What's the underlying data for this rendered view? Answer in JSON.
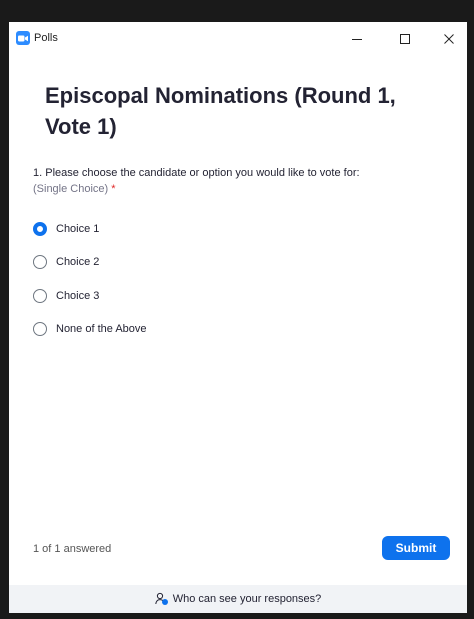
{
  "window": {
    "title": "Polls",
    "app_icon": "zoom-video-icon",
    "controls": {
      "minimize_icon": "minimize-icon",
      "maximize_icon": "maximize-icon",
      "close_icon": "close-icon"
    }
  },
  "poll": {
    "title": "Episcopal Nominations (Round 1, Vote 1)",
    "question": {
      "text": "1. Please choose the candidate or option you would like to vote for:",
      "type": "(Single Choice)",
      "required_marker": "*"
    },
    "options": [
      {
        "label": "Choice 1",
        "selected": true
      },
      {
        "label": "Choice 2",
        "selected": false
      },
      {
        "label": "Choice 3",
        "selected": false
      },
      {
        "label": "None of the Above",
        "selected": false
      }
    ],
    "progress": "1 of 1 answered",
    "submit_label": "Submit"
  },
  "footer": {
    "icon": "privacy-people-icon",
    "text": "Who can see your responses?"
  },
  "colors": {
    "accent": "#0e72ed",
    "required": "#e02828",
    "footer_bg": "#f1f3f6"
  }
}
